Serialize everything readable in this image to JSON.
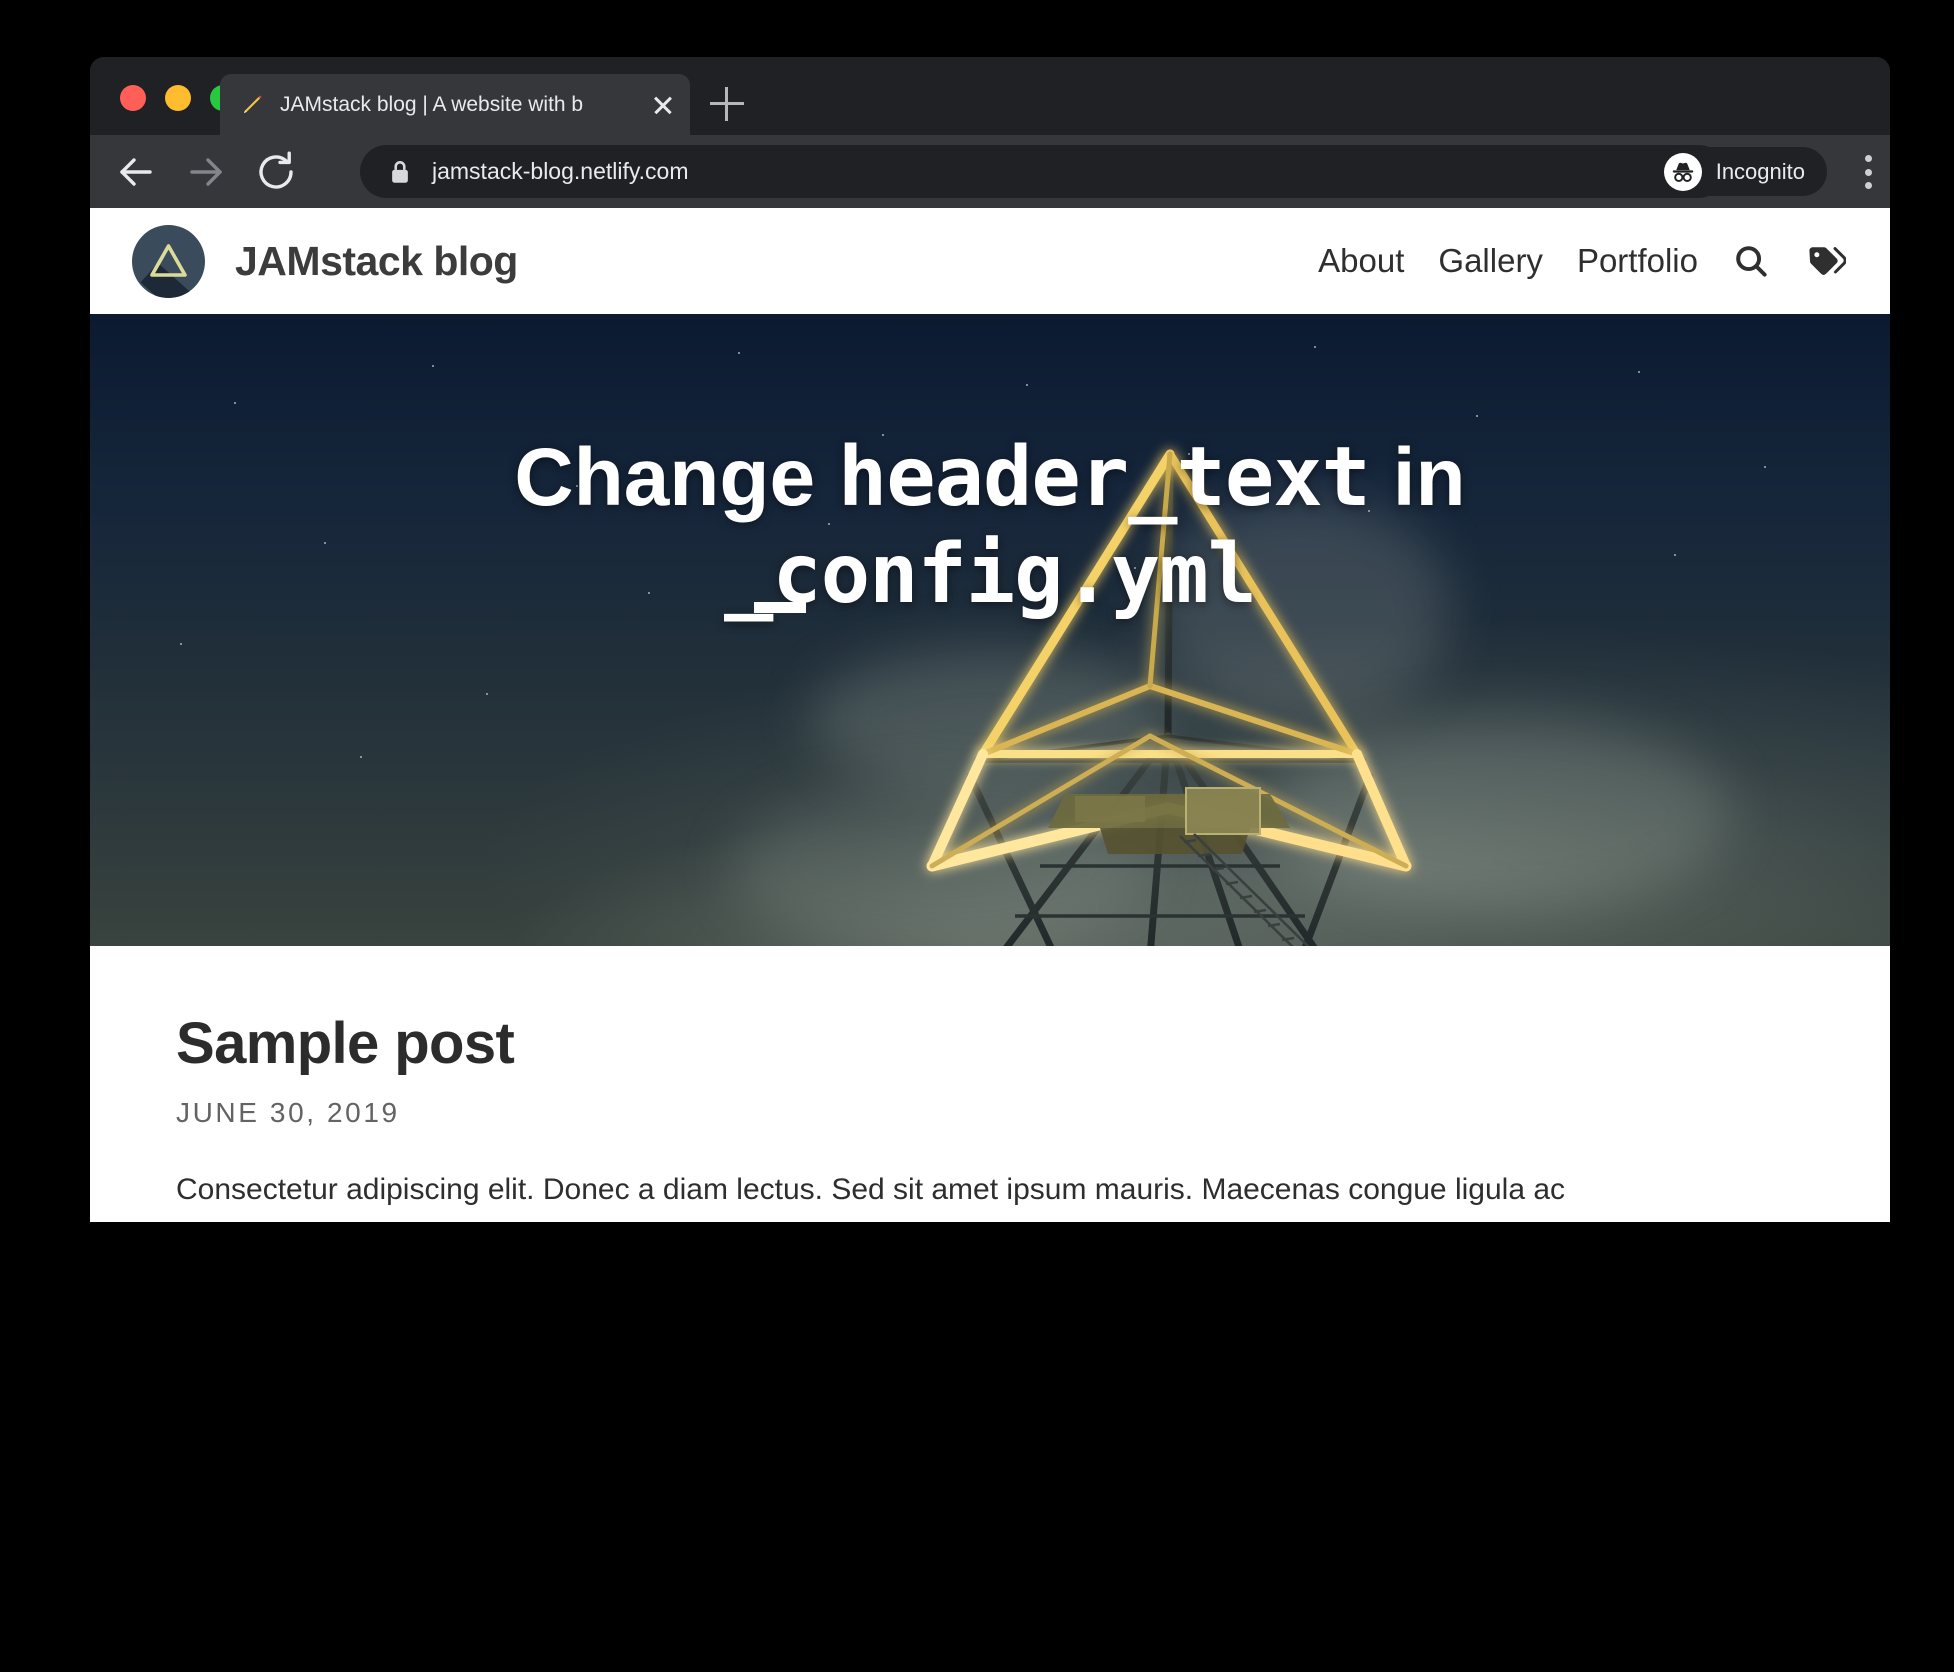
{
  "browser": {
    "tab": {
      "title": "JAMstack blog | A website with b",
      "favicon_icon": "pencil-icon",
      "close_icon": "close-icon"
    },
    "new_tab_icon": "plus-icon",
    "back_icon": "back-arrow-icon",
    "forward_icon": "forward-arrow-icon",
    "reload_icon": "reload-icon",
    "omnibox": {
      "lock_icon": "lock-icon",
      "url": "jamstack-blog.netlify.com",
      "star_icon": "star-icon"
    },
    "incognito": {
      "label": "Incognito",
      "icon": "incognito-icon"
    },
    "menu_icon": "kebab-menu-icon",
    "colors": {
      "tabstrip_bg": "#202124",
      "toolbar_bg": "#35373b",
      "active_tab_bg": "#35373b",
      "omnibox_bg": "#202124",
      "traffic_red": "#ff5f57",
      "traffic_yellow": "#febc2e",
      "traffic_green": "#28c840"
    }
  },
  "site": {
    "brand": {
      "name": "JAMstack blog",
      "logo_icon": "triangle-logo-icon",
      "logo_circle_color": "#3a4b5c",
      "logo_triangle_color": "#dcdc9a"
    },
    "nav": [
      {
        "label": "About"
      },
      {
        "label": "Gallery"
      },
      {
        "label": "Portfolio"
      }
    ],
    "nav_icons": [
      {
        "name": "search-icon"
      },
      {
        "name": "tags-icon"
      }
    ],
    "hero": {
      "line1_prefix": "Change ",
      "line1_code": "header_text",
      "line1_suffix": " in",
      "line2_code": "_config.yml",
      "caret": "cursor-underscore"
    },
    "post": {
      "title": "Sample post",
      "date": "JUNE 30, 2019",
      "body": "Consectetur adipiscing elit. Donec a diam lectus. Sed sit amet ipsum mauris. Maecenas congue ligula ac quam viverra nec consectetur ante hendrerit. Donec et mollis dolor. Praesent et diam eget libero egestas mattis sit amet vitae augue. Nam tincidunt congue enim, ut porta lorem lacinia consectetur."
    }
  }
}
